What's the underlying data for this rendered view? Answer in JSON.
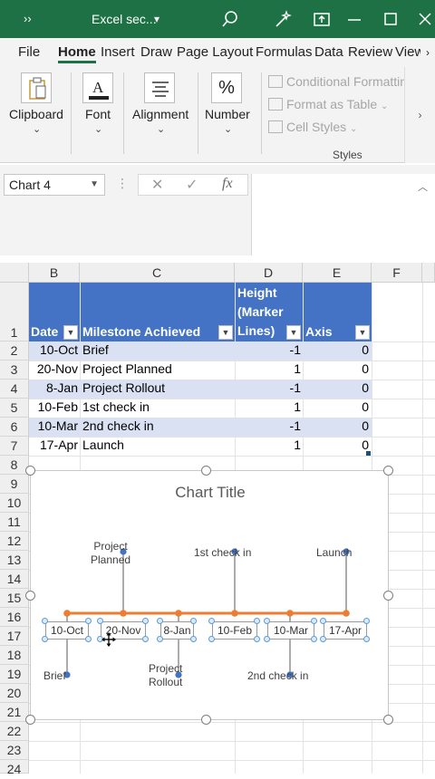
{
  "title_bar": {
    "chevrons": "››",
    "file_name": "Excel sec...",
    "dropdown": "▾"
  },
  "tabs": [
    "File",
    "Home",
    "Insert",
    "Draw",
    "Page Layout",
    "Formulas",
    "Data",
    "Review",
    "View"
  ],
  "active_tab": "Home",
  "ribbon": {
    "clipboard": "Clipboard",
    "font": "Font",
    "alignment": "Alignment",
    "number": "Number",
    "number_glyph": "%",
    "conditional_formatting": "Conditional Formattin",
    "format_as_table": "Format as Table",
    "cell_styles": "Cell Styles",
    "styles_group": "Styles"
  },
  "name_box": "Chart 4",
  "fx": "fx",
  "columns": [
    "B",
    "C",
    "D",
    "E",
    "F"
  ],
  "rows": [
    "1",
    "2",
    "3",
    "4",
    "5",
    "6",
    "7",
    "8",
    "9",
    "10",
    "11",
    "12",
    "13",
    "14",
    "15",
    "16",
    "17",
    "18",
    "19",
    "20",
    "21",
    "22",
    "23",
    "24"
  ],
  "table": {
    "headers": [
      "Date",
      "Milestone Achieved",
      "Height (Marker Lines)",
      "Axis"
    ],
    "header_lines": {
      "height": [
        "Height",
        "(Marker",
        "Lines)"
      ]
    },
    "rows": [
      [
        "10-Oct",
        "Brief",
        "-1",
        "0"
      ],
      [
        "20-Nov",
        "Project Planned",
        "1",
        "0"
      ],
      [
        "8-Jan",
        "Project Rollout",
        "-1",
        "0"
      ],
      [
        "10-Feb",
        "1st check in",
        "1",
        "0"
      ],
      [
        "10-Mar",
        "2nd check in",
        "-1",
        "0"
      ],
      [
        "17-Apr",
        "Launch",
        "1",
        "0"
      ]
    ]
  },
  "chart": {
    "title": "Chart Title",
    "milestone_labels": [
      [
        "Brief"
      ],
      [
        "Project",
        "Planned"
      ],
      [
        "Project",
        "Rollout"
      ],
      [
        "1st check in"
      ],
      [
        "2nd check in"
      ],
      [
        "Launch"
      ]
    ],
    "axis_labels": [
      "10-Oct",
      "20-Nov",
      "8-Jan",
      "10-Feb",
      "10-Mar",
      "17-Apr"
    ],
    "colors": {
      "axis_line": "#ed7d31",
      "marker": "#4472c4",
      "stem": "#7f7f7f"
    }
  },
  "chart_data": {
    "type": "scatter",
    "title": "Chart Title",
    "categories": [
      "10-Oct",
      "20-Nov",
      "8-Jan",
      "10-Feb",
      "10-Mar",
      "17-Apr"
    ],
    "series": [
      {
        "name": "Height (Marker Lines)",
        "values": [
          -1,
          1,
          -1,
          1,
          -1,
          1
        ]
      },
      {
        "name": "Axis",
        "values": [
          0,
          0,
          0,
          0,
          0,
          0
        ]
      }
    ],
    "annotations": [
      "Brief",
      "Project Planned",
      "Project Rollout",
      "1st check in",
      "2nd check in",
      "Launch"
    ],
    "grid": false
  }
}
